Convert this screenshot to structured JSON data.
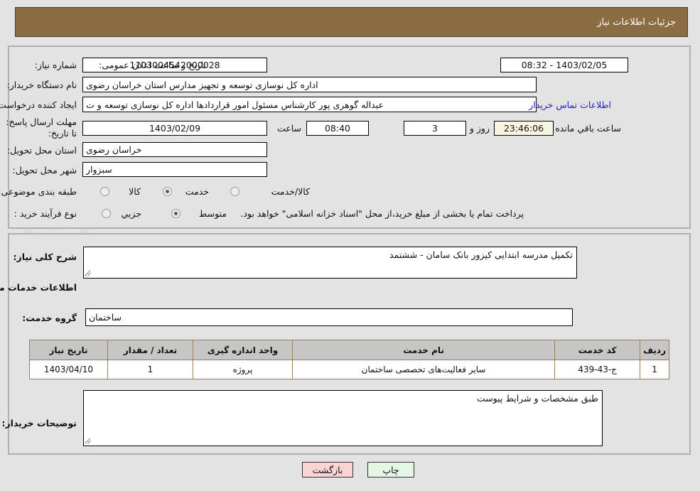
{
  "header": {
    "title": "جزئیات اطلاعات نیاز",
    "bar_color": "#8c6c43"
  },
  "watermark": {
    "text": "ArtaTender.net"
  },
  "top_section": {
    "need_number": {
      "label": "شماره نیاز:",
      "value": "1103004542000028"
    },
    "public_announce": {
      "label": "تاریخ و ساعت اعلان عمومی:",
      "value": "1403/02/05 - 08:32"
    },
    "buyer_org": {
      "label": "نام دستگاه خریدار:",
      "value": "اداره کل نوسازی  توسعه و تجهیز مدارس استان خراسان رضوی"
    },
    "requester": {
      "label": "ایجاد کننده درخواست:",
      "value": "عبداله گوهری پور کارشناس مسئول امور قراردادها  اداره کل نوسازی  توسعه و ت",
      "contact_link": "اطلاعات تماس خریدار"
    },
    "deadline": {
      "label": "مهلت ارسال پاسخ: تا تاریخ:",
      "date": "1403/02/09",
      "hour_label": "ساعت",
      "hour": "08:40",
      "days": "3",
      "days_label": "روز و",
      "countdown": "23:46:06",
      "countdown_label": "ساعت باقي مانده"
    },
    "province": {
      "label": "استان محل تحویل:",
      "value": "خراسان رضوی"
    },
    "city": {
      "label": "شهر محل تحویل:",
      "value": "سبزوار"
    },
    "subject_class": {
      "label": "طبقه بندی موضوعی:",
      "options": [
        {
          "label": "کالا",
          "selected": false
        },
        {
          "label": "خدمت",
          "selected": true
        },
        {
          "label": "کالا/خدمت",
          "selected": false
        }
      ]
    },
    "purchase_type": {
      "label": "نوع فرآیند خرید :",
      "options": [
        {
          "label": "جزیي",
          "selected": false
        },
        {
          "label": "متوسط",
          "selected": true
        }
      ],
      "note": "پرداخت تمام یا بخشی از مبلغ خرید،از محل \"اسناد خزانه اسلامی\" خواهد بود."
    }
  },
  "mid_section": {
    "general_description": {
      "label": "شرح کلی نیاز:",
      "value": "تکمیل مدرسه ابتدایی کیزور بانک سامان - ششتمد"
    },
    "services_heading": "اطلاعات خدمات مورد نیاز",
    "service_group": {
      "label": "گروه خدمت:",
      "value": "ساختمان"
    },
    "table": {
      "columns": [
        "ردیف",
        "کد خدمت",
        "نام خدمت",
        "واحد اندازه گیری",
        "تعداد / مقدار",
        "تاریخ نیاز"
      ],
      "rows": [
        {
          "row_no": "1",
          "service_code": "ج-43-439",
          "service_name": "سایر فعالیت‌های تخصصی ساختمان",
          "unit": "پروژه",
          "quantity": "1",
          "need_date": "1403/04/10"
        }
      ]
    },
    "buyer_notes": {
      "label": "توضیحات خریدار:",
      "value": "طبق مشخصات و شرایط پیوست"
    }
  },
  "footer": {
    "back_button": "بازگشت",
    "print_button": "چاپ"
  }
}
